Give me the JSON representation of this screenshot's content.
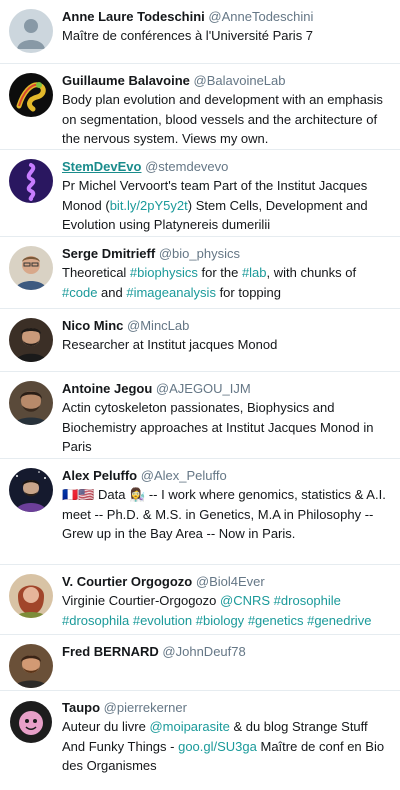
{
  "accent_color": "#1b9a9a",
  "profiles": [
    {
      "name": "Anne Laure Todeschini",
      "handle": "@AnneTodeschini",
      "bio": [
        {
          "text": "Maître de conférences à l'Université Paris 7"
        }
      ]
    },
    {
      "name": "Guillaume Balavoine",
      "handle": "@BalavoineLab",
      "bio": [
        {
          "text": "Body plan evolution and development with an emphasis on segmentation, blood vessels and the architecture of the nervous system. Views my own."
        }
      ]
    },
    {
      "name": "StemDevEvo",
      "handle": "@stemdevevo",
      "bio": [
        {
          "text": "Pr Michel Vervoort's team Part of the Institut Jacques Monod ("
        },
        {
          "text": "bit.ly/2pY5y2t",
          "link": true
        },
        {
          "text": ") Stem Cells, Development and Evolution using Platynereis dumerilii"
        }
      ]
    },
    {
      "name": "Serge Dmitrieff",
      "handle": "@bio_physics",
      "bio": [
        {
          "text": "Theoretical "
        },
        {
          "text": "#biophysics",
          "link": true
        },
        {
          "text": " for the "
        },
        {
          "text": "#lab",
          "link": true
        },
        {
          "text": ", with chunks of "
        },
        {
          "text": "#code",
          "link": true
        },
        {
          "text": " and "
        },
        {
          "text": "#imageanalysis",
          "link": true
        },
        {
          "text": " for topping"
        }
      ]
    },
    {
      "name": "Nico Minc",
      "handle": "@MincLab",
      "bio": [
        {
          "text": "Researcher at Institut jacques Monod"
        }
      ]
    },
    {
      "name": "Antoine Jegou",
      "handle": "@AJEGOU_IJM",
      "bio": [
        {
          "text": "Actin cytoskeleton passionates, Biophysics and Biochemistry approaches at Institut Jacques Monod in Paris"
        }
      ]
    },
    {
      "name": "Alex Peluffo",
      "handle": "@Alex_Peluffo",
      "bio": [
        {
          "text": "🇫🇷🇺🇸 Data 👩‍🔬 -- I work where genomics, statistics & A.I. meet -- Ph.D. & M.S. in Genetics, M.A in Philosophy -- Grew up in the Bay Area -- Now in Paris."
        }
      ]
    },
    {
      "name": "V. Courtier Orgogozo",
      "handle": "@Biol4Ever",
      "bio": [
        {
          "text": "Virginie Courtier-Orgogozo "
        },
        {
          "text": "@CNRS",
          "link": true
        },
        {
          "text": " "
        },
        {
          "text": "#drosophile",
          "link": true
        },
        {
          "text": " "
        },
        {
          "text": "#drosophila",
          "link": true
        },
        {
          "text": " "
        },
        {
          "text": "#evolution",
          "link": true
        },
        {
          "text": " "
        },
        {
          "text": "#biology",
          "link": true
        },
        {
          "text": " "
        },
        {
          "text": "#genetics",
          "link": true
        },
        {
          "text": " "
        },
        {
          "text": "#genedrive",
          "link": true
        }
      ]
    },
    {
      "name": "Fred BERNARD",
      "handle": "@JohnDeuf78",
      "bio": []
    },
    {
      "name": "Taupo",
      "handle": "@pierrekerner",
      "bio": [
        {
          "text": "Auteur du livre "
        },
        {
          "text": "@moiparasite",
          "link": true
        },
        {
          "text": " & du blog Strange Stuff And Funky Things - "
        },
        {
          "text": "goo.gl/SU3ga",
          "link": true
        },
        {
          "text": " Maître de conf en Bio des Organismes"
        }
      ]
    }
  ]
}
